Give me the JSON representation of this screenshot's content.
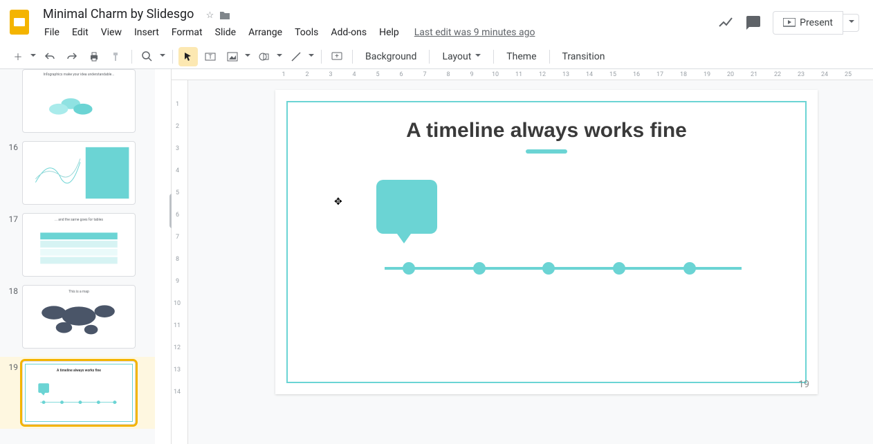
{
  "doc": {
    "title": "Minimal Charm by Slidesgo",
    "last_edit": "Last edit was 9 minutes ago"
  },
  "menu": {
    "file": "File",
    "edit": "Edit",
    "view": "View",
    "insert": "Insert",
    "format": "Format",
    "slide": "Slide",
    "arrange": "Arrange",
    "tools": "Tools",
    "addons": "Add-ons",
    "help": "Help"
  },
  "header": {
    "present": "Present"
  },
  "toolbar": {
    "background": "Background",
    "layout": "Layout",
    "theme": "Theme",
    "transition": "Transition"
  },
  "ruler_h": [
    "1",
    "2",
    "3",
    "4",
    "5",
    "6",
    "7",
    "8",
    "9",
    "10",
    "11",
    "12",
    "13",
    "14",
    "15",
    "16",
    "17",
    "18",
    "19",
    "20",
    "21",
    "22",
    "23",
    "24",
    "25"
  ],
  "ruler_v": [
    "1",
    "2",
    "3",
    "4",
    "5",
    "6",
    "7",
    "8",
    "9",
    "10",
    "11",
    "12",
    "13",
    "14"
  ],
  "thumbs": {
    "t15_caption": "Infographics make your idea understandable...",
    "t16_num": "16",
    "t17_num": "17",
    "t17_caption": "... and the same goes for tables",
    "t18_num": "18",
    "t18_caption": "This is a map",
    "t19_num": "19",
    "t19_caption": "A timeline always works fine"
  },
  "slide": {
    "title": "A timeline always works fine",
    "number": "19"
  }
}
